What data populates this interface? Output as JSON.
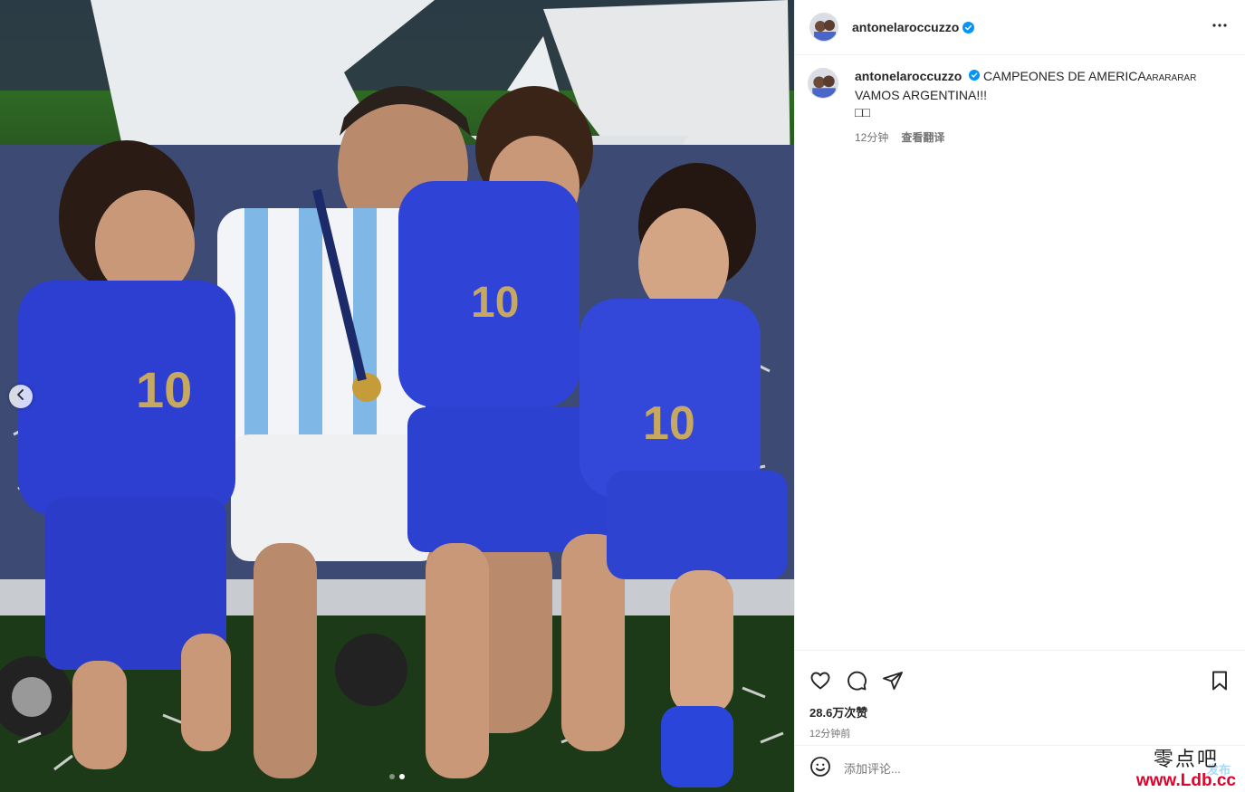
{
  "post": {
    "author": {
      "username": "antonelaroccuzzo",
      "verified": true
    },
    "caption": {
      "username": "antonelaroccuzzo",
      "text_main": "CAMPEONES DE AMERICA",
      "text_suffix": "ARARARAR",
      "line2": "VAMOS ARGENTINA!!!",
      "line3": "□□",
      "time_ago": "12分钟",
      "translate_label": "查看翻译"
    },
    "likes_label": "28.6万次赞",
    "timestamp": "12分钟前",
    "comment_placeholder": "添加评论...",
    "post_button_label": "发布",
    "carousel": {
      "slide_count": 2,
      "active_slide": 2
    }
  },
  "icons": {
    "like": "heart-icon",
    "comment": "comment-bubble-icon",
    "share": "paper-plane-icon",
    "save": "bookmark-icon",
    "more": "more-horizontal-icon",
    "emoji": "smiley-icon",
    "prev": "chevron-left-icon",
    "verified": "verified-badge-icon"
  },
  "colors": {
    "verified_blue": "#0095f6",
    "text": "#262626",
    "muted": "#737373",
    "border": "#efefef"
  },
  "watermark": {
    "chinese": "零点吧",
    "url": "www.Ldb.cc"
  }
}
